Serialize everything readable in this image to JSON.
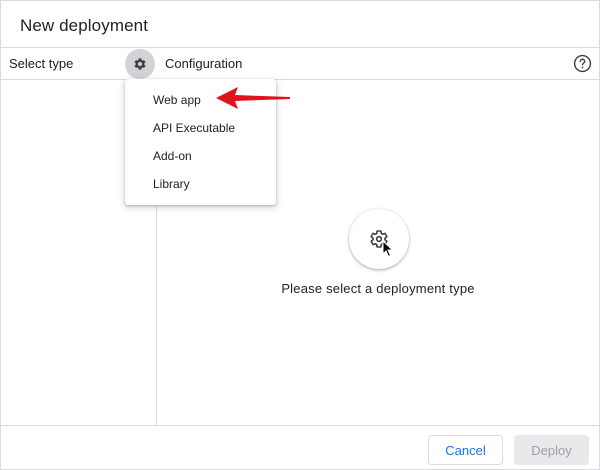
{
  "dialog": {
    "title": "New deployment"
  },
  "header": {
    "select_type_label": "Select type",
    "configuration_label": "Configuration",
    "gear_icon": "gear-icon",
    "help_icon": "help-circle-icon"
  },
  "menu": {
    "items": [
      {
        "label": "Web app"
      },
      {
        "label": "API Executable"
      },
      {
        "label": "Add-on"
      },
      {
        "label": "Library"
      }
    ]
  },
  "main": {
    "empty_icon": "gear-icon",
    "empty_message": "Please select a deployment type"
  },
  "footer": {
    "cancel_label": "Cancel",
    "deploy_label": "Deploy"
  },
  "colors": {
    "accent": "#1a73e8",
    "annotation": "#e0121c",
    "divider": "#dadce0"
  }
}
